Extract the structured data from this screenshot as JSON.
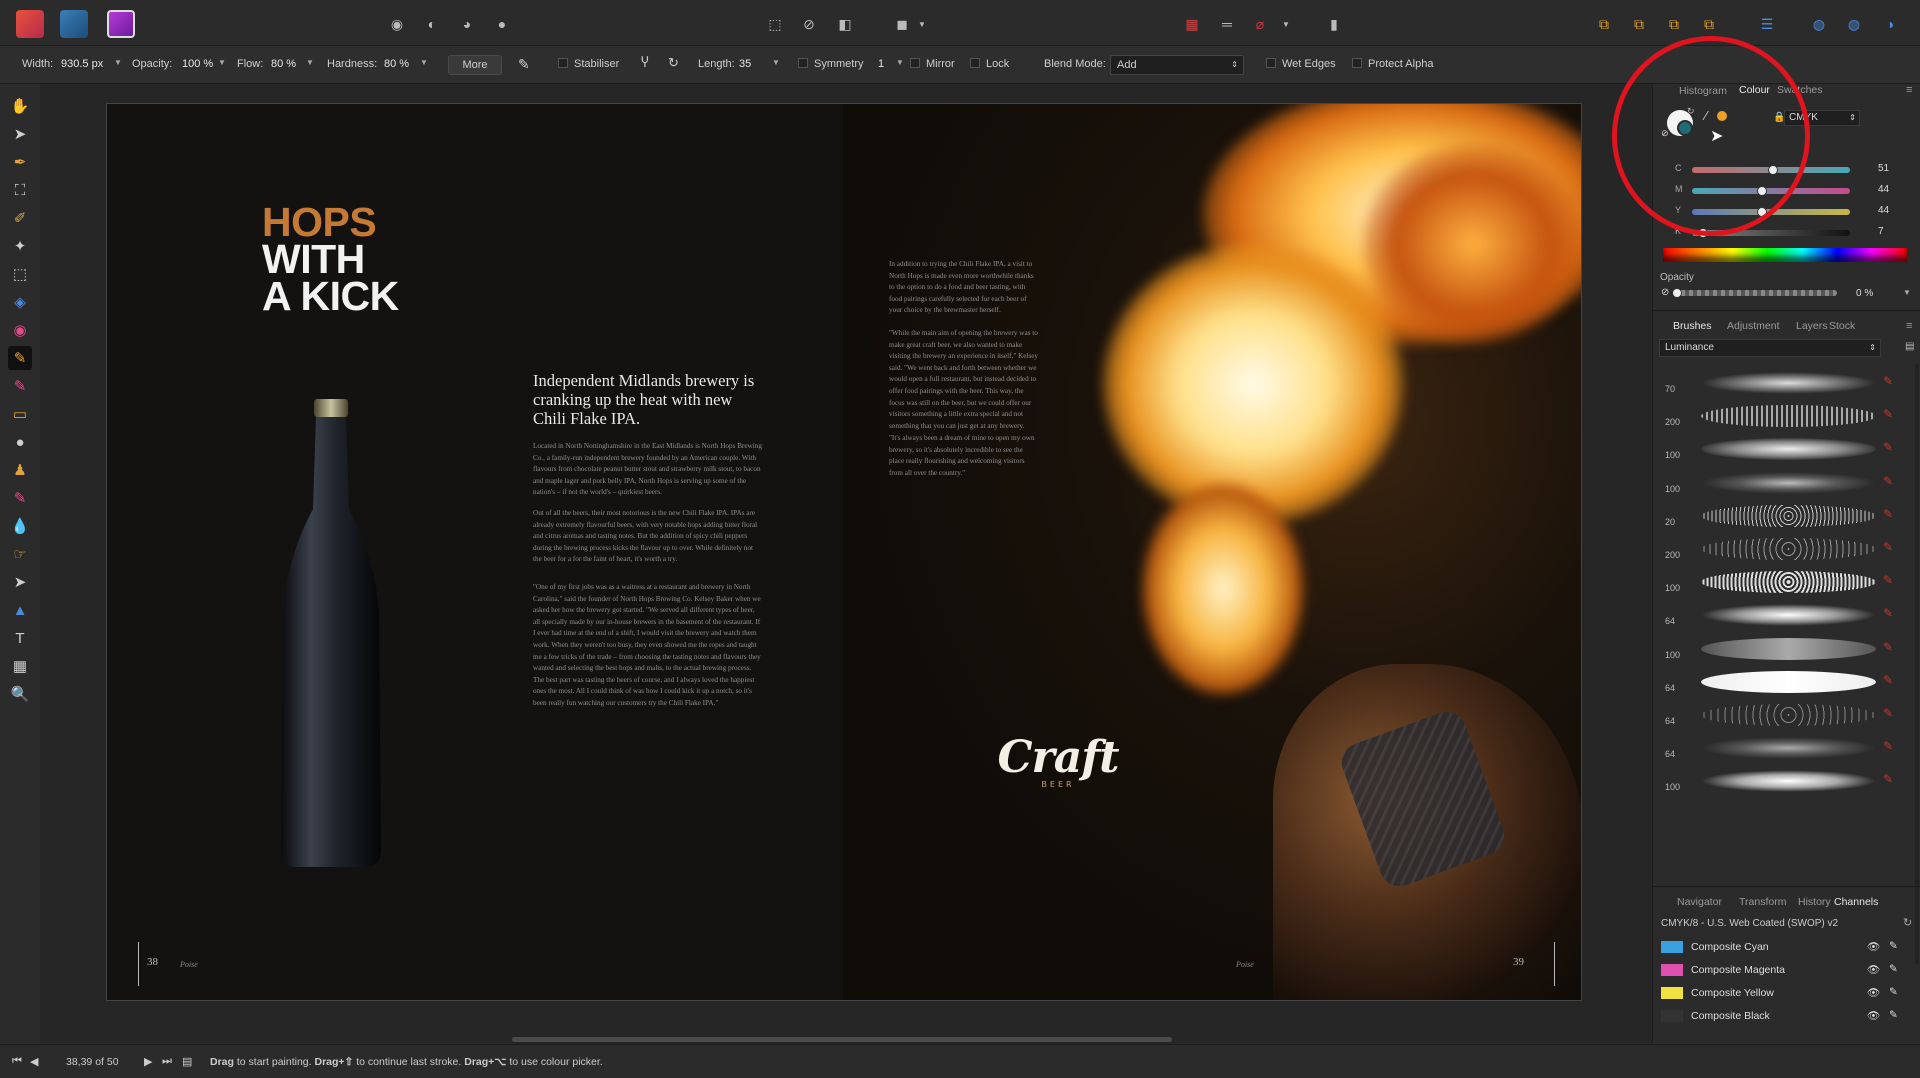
{
  "toolbar": {
    "width_label": "Width:",
    "width_value": "930.5 px",
    "opacity_label": "Opacity:",
    "opacity_value": "100 %",
    "flow_label": "Flow:",
    "flow_value": "80 %",
    "hardness_label": "Hardness:",
    "hardness_value": "80 %",
    "more_label": "More",
    "stabiliser_label": "Stabiliser",
    "length_label": "Length:",
    "length_value": "35",
    "symmetry_label": "Symmetry",
    "symmetry_value": "1",
    "mirror_label": "Mirror",
    "lock_label": "Lock",
    "blend_label": "Blend Mode:",
    "blend_value": "Add",
    "wet_edges_label": "Wet Edges",
    "protect_alpha_label": "Protect Alpha"
  },
  "document": {
    "headline_1": "HOPS",
    "headline_2": "WITH",
    "headline_3": "A KICK",
    "intro": "Independent Midlands brewery is cranking up the heat with new Chili Flake IPA.",
    "body_left_1": "Located in North Nottinghamshire in the East Midlands is North Hops Brewing Co., a family-run independent brewery founded by an American couple. With flavours from chocolate peanut butter stout and strawberry milk stout, to bacon and maple lager and pork belly IPA, North Hops is serving up some of the nation's – if not the world's – quirkiest beers.",
    "body_left_2": "Out of all the beers, their most notorious is the new Chili Flake IPA. IPAs are already extremely flavourful beers, with very notable hops adding bitter floral and citrus aromas and tasting notes. But the addition of spicy chili peppers during the brewing process kicks the flavour up to over. While definitely not the beer for a for the faint of heart, it's worth a try.",
    "body_left_3": "\"One of my first jobs was as a waitress at a restaurant and brewery in North Carolina,\" said the founder of North Hops Brewing Co. Kelsey Baker when we asked her how the brewery got started. \"We served all different types of beer, all specially made by our in-house brewers in the basement of the restaurant. If I ever had time at the end of a shift, I would visit the brewery and watch them work. When they weren't too busy, they even showed me the ropes and taught me a few tricks of the trade – from choosing the tasting notes and flavours they wanted and selecting the best hops and malts, to the actual brewing process. The best part was tasting the beers of course, and I always loved the happiest ones the most. All I could think of was how I could kick it up a notch, so it's been really fun watching our customers try the Chili Flake IPA.\"",
    "body_right_1": "In addition to trying the Chili Flake IPA, a visit to North Hops is made even more worthwhile thanks to the option to do a food and beer tasting, with food pairings carefully selected for each beer of your choice by the brewmaster herself.",
    "body_right_2": "\"While the main aim of opening the brewery was to make great craft beer, we also wanted to make visiting the brewery an experience in itself,\" Kelsey said. \"We went back and forth between whether we would open a full restaurant, but instead decided to offer food pairings with the beer. This way, the focus was still on the beer, but we could offer our visitors something a little extra special and not something that you can just get at any brewery.",
    "body_right_3": "\"It's always been a dream of mine to open my own brewery, so it's absolutely incredible to see the place really flourishing and welcoming visitors from all over the country.\"",
    "page_left": "38",
    "page_right": "39",
    "folio_left": "Poise",
    "folio_right": "Poise",
    "logo_text": "Craft",
    "logo_sub": "BEER"
  },
  "colour_panel": {
    "tabs": [
      "Histogram",
      "Colour",
      "Swatches"
    ],
    "model": "CMYK",
    "sliders": [
      {
        "label": "C",
        "value": "51",
        "fraction": 0.51
      },
      {
        "label": "M",
        "value": "44",
        "fraction": 0.44
      },
      {
        "label": "Y",
        "value": "44",
        "fraction": 0.44
      },
      {
        "label": "K",
        "value": "7",
        "fraction": 0.07
      }
    ],
    "opacity_label": "Opacity",
    "opacity_value": "0 %",
    "opacity_fraction": 0.0
  },
  "brushes_panel": {
    "tabs": [
      "Brushes",
      "Adjustment",
      "Layers",
      "Stock"
    ],
    "category": "Luminance",
    "sizes": [
      "70",
      "200",
      "100",
      "100",
      "20",
      "200",
      "100",
      "64",
      "100",
      "64",
      "64",
      "64",
      "100"
    ]
  },
  "channels_panel": {
    "tabs": [
      "Navigator",
      "Transform",
      "History",
      "Channels"
    ],
    "profile": "CMYK/8 - U.S. Web Coated (SWOP) v2",
    "channels": [
      {
        "name": "Composite Cyan",
        "color": "#3aa0e0"
      },
      {
        "name": "Composite Magenta",
        "color": "#e050b0"
      },
      {
        "name": "Composite Yellow",
        "color": "#f0e040"
      },
      {
        "name": "Composite Black",
        "color": "#333333"
      }
    ]
  },
  "statusbar": {
    "page_info": "38,39 of 50",
    "hint_drag": "Drag",
    "hint_1": " to start painting. ",
    "hint_drag2": "Drag+⇧",
    "hint_2": " to continue last stroke. ",
    "hint_drag3": "Drag+⌥",
    "hint_3": " to use colour picker."
  },
  "colors": {
    "accent_orange": "#c47a35",
    "annotation_red": "#e0141e"
  }
}
